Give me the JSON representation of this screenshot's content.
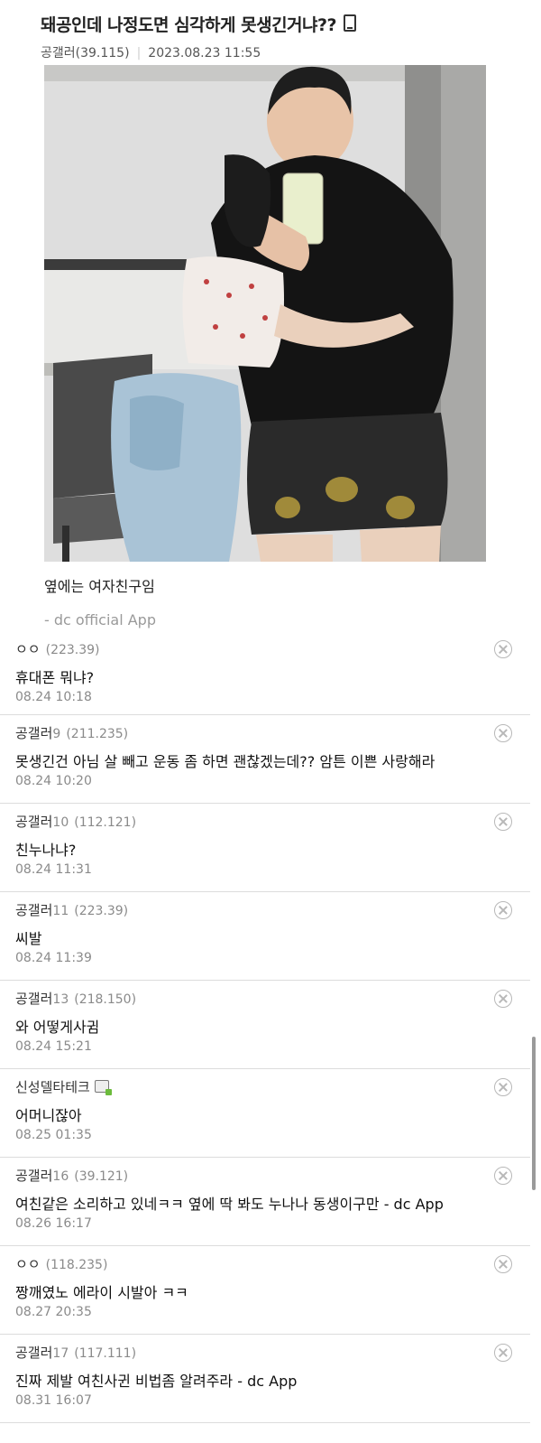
{
  "post": {
    "title": "돼공인데 나정도면 심각하게 못생긴거냐??",
    "title_icon": "phone-icon",
    "author": "공갤러(39.115)",
    "date": "2023.08.23 11:55",
    "caption": "옆에는 여자친구임",
    "signature": "- dc official App"
  },
  "comments": [
    {
      "name": "ㅇㅇ",
      "num": "",
      "ip": "(223.39)",
      "text": "휴대폰 뭐냐?",
      "date": "08.24 10:18"
    },
    {
      "name": "공갤러",
      "num": "9",
      "ip": "(211.235)",
      "text": "못생긴건 아님 살 빼고 운동 좀 하면 괜찮겠는데?? 암튼 이쁜 사랑해라",
      "date": "08.24 10:20"
    },
    {
      "name": "공갤러",
      "num": "10",
      "ip": "(112.121)",
      "text": "친누나냐?",
      "date": "08.24 11:31"
    },
    {
      "name": "공갤러",
      "num": "11",
      "ip": "(223.39)",
      "text": "씨발",
      "date": "08.24 11:39"
    },
    {
      "name": "공갤러",
      "num": "13",
      "ip": "(218.150)",
      "text": "와 어떻게사귐",
      "date": "08.24 15:21"
    },
    {
      "name": "신성델타테크",
      "num": "",
      "ip": "",
      "text": "어머니잖아",
      "date": "08.25 01:35"
    },
    {
      "name": "공갤러",
      "num": "16",
      "ip": "(39.121)",
      "text": "여친같은 소리하고 있네ㅋㅋ 옆에 딱 봐도 누나나 동생이구만 - dc App",
      "date": "08.26 16:17"
    },
    {
      "name": "ㅇㅇ",
      "num": "",
      "ip": "(118.235)",
      "text": "짱깨였노 에라이 시발아 ㅋㅋ",
      "date": "08.27 20:35"
    },
    {
      "name": "공갤러",
      "num": "17",
      "ip": "(117.111)",
      "text": "진짜 제발 여친사귄 비법좀 알려주라 - dc App",
      "date": "08.31 16:07"
    }
  ]
}
